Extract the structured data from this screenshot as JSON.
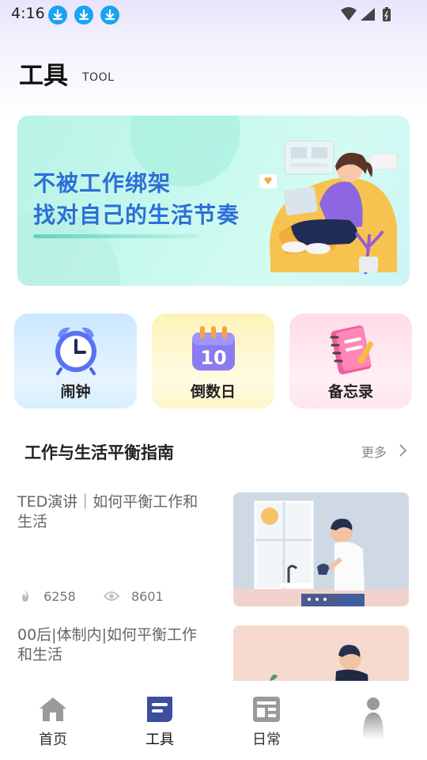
{
  "status": {
    "time": "4:16"
  },
  "header": {
    "title": "工具",
    "subtitle": "TOOL"
  },
  "banner": {
    "line1": "不被工作绑架",
    "line2": "找对自己的生活节奏"
  },
  "tools": [
    {
      "label": "闹钟",
      "icon": "alarm-clock-icon"
    },
    {
      "label": "倒数日",
      "icon": "calendar-icon",
      "icon_text": "10"
    },
    {
      "label": "备忘录",
      "icon": "notebook-icon"
    }
  ],
  "section": {
    "title": "工作与生活平衡指南",
    "more": "更多"
  },
  "articles": [
    {
      "title": "TED演讲｜如何平衡工作和生活",
      "likes": "6258",
      "views": "8601"
    },
    {
      "title": "00后|体制内|如何平衡工作和生活"
    }
  ],
  "tabbar": [
    {
      "label": "首页",
      "icon": "home-icon"
    },
    {
      "label": "工具",
      "icon": "tools-icon"
    },
    {
      "label": "日常",
      "icon": "daily-icon"
    },
    {
      "label": "",
      "icon": "profile-icon"
    }
  ],
  "colors": {
    "accent": "#2c6fd8",
    "download_badge": "#1aa3f2",
    "active_tab": "#3d4e9f"
  }
}
